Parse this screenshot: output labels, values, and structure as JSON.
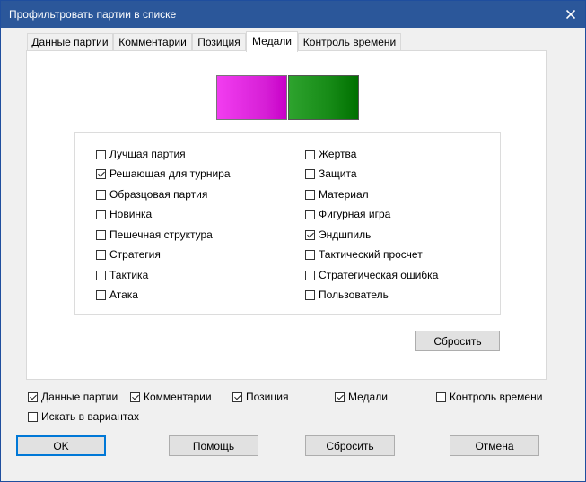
{
  "window": {
    "title": "Профильтровать партии в списке"
  },
  "tabs": [
    {
      "label": "Данные партии"
    },
    {
      "label": "Комментарии"
    },
    {
      "label": "Позиция"
    },
    {
      "label": "Медали",
      "active": true
    },
    {
      "label": "Контроль времени"
    }
  ],
  "medals": {
    "swatch_colors": [
      "#e52ee5",
      "#168a16"
    ],
    "left_column": [
      {
        "label": "Лучшая партия",
        "checked": false
      },
      {
        "label": "Решающая для турнира",
        "checked": true
      },
      {
        "label": "Образцовая партия",
        "checked": false
      },
      {
        "label": "Новинка",
        "checked": false
      },
      {
        "label": "Пешечная структура",
        "checked": false
      },
      {
        "label": "Стратегия",
        "checked": false
      },
      {
        "label": "Тактика",
        "checked": false
      },
      {
        "label": "Атака",
        "checked": false
      }
    ],
    "right_column": [
      {
        "label": "Жертва",
        "checked": false
      },
      {
        "label": "Защита",
        "checked": false
      },
      {
        "label": "Материал",
        "checked": false
      },
      {
        "label": "Фигурная игра",
        "checked": false
      },
      {
        "label": "Эндшпиль",
        "checked": true
      },
      {
        "label": "Тактический просчет",
        "checked": false
      },
      {
        "label": "Стратегическая ошибка",
        "checked": false
      },
      {
        "label": "Пользователь",
        "checked": false
      }
    ],
    "reset_label": "Сбросить"
  },
  "filters": [
    {
      "label": "Данные партии",
      "checked": true
    },
    {
      "label": "Комментарии",
      "checked": true
    },
    {
      "label": "Позиция",
      "checked": true
    },
    {
      "label": "Медали",
      "checked": true
    },
    {
      "label": "Контроль времени",
      "checked": false
    }
  ],
  "search_variations": {
    "label": "Искать в вариантах",
    "checked": false
  },
  "buttons": {
    "ok": "OK",
    "help": "Помощь",
    "reset": "Сбросить",
    "cancel": "Отмена"
  },
  "colors": {
    "titlebar": "#2b579a",
    "default_button_border": "#0078d7"
  }
}
